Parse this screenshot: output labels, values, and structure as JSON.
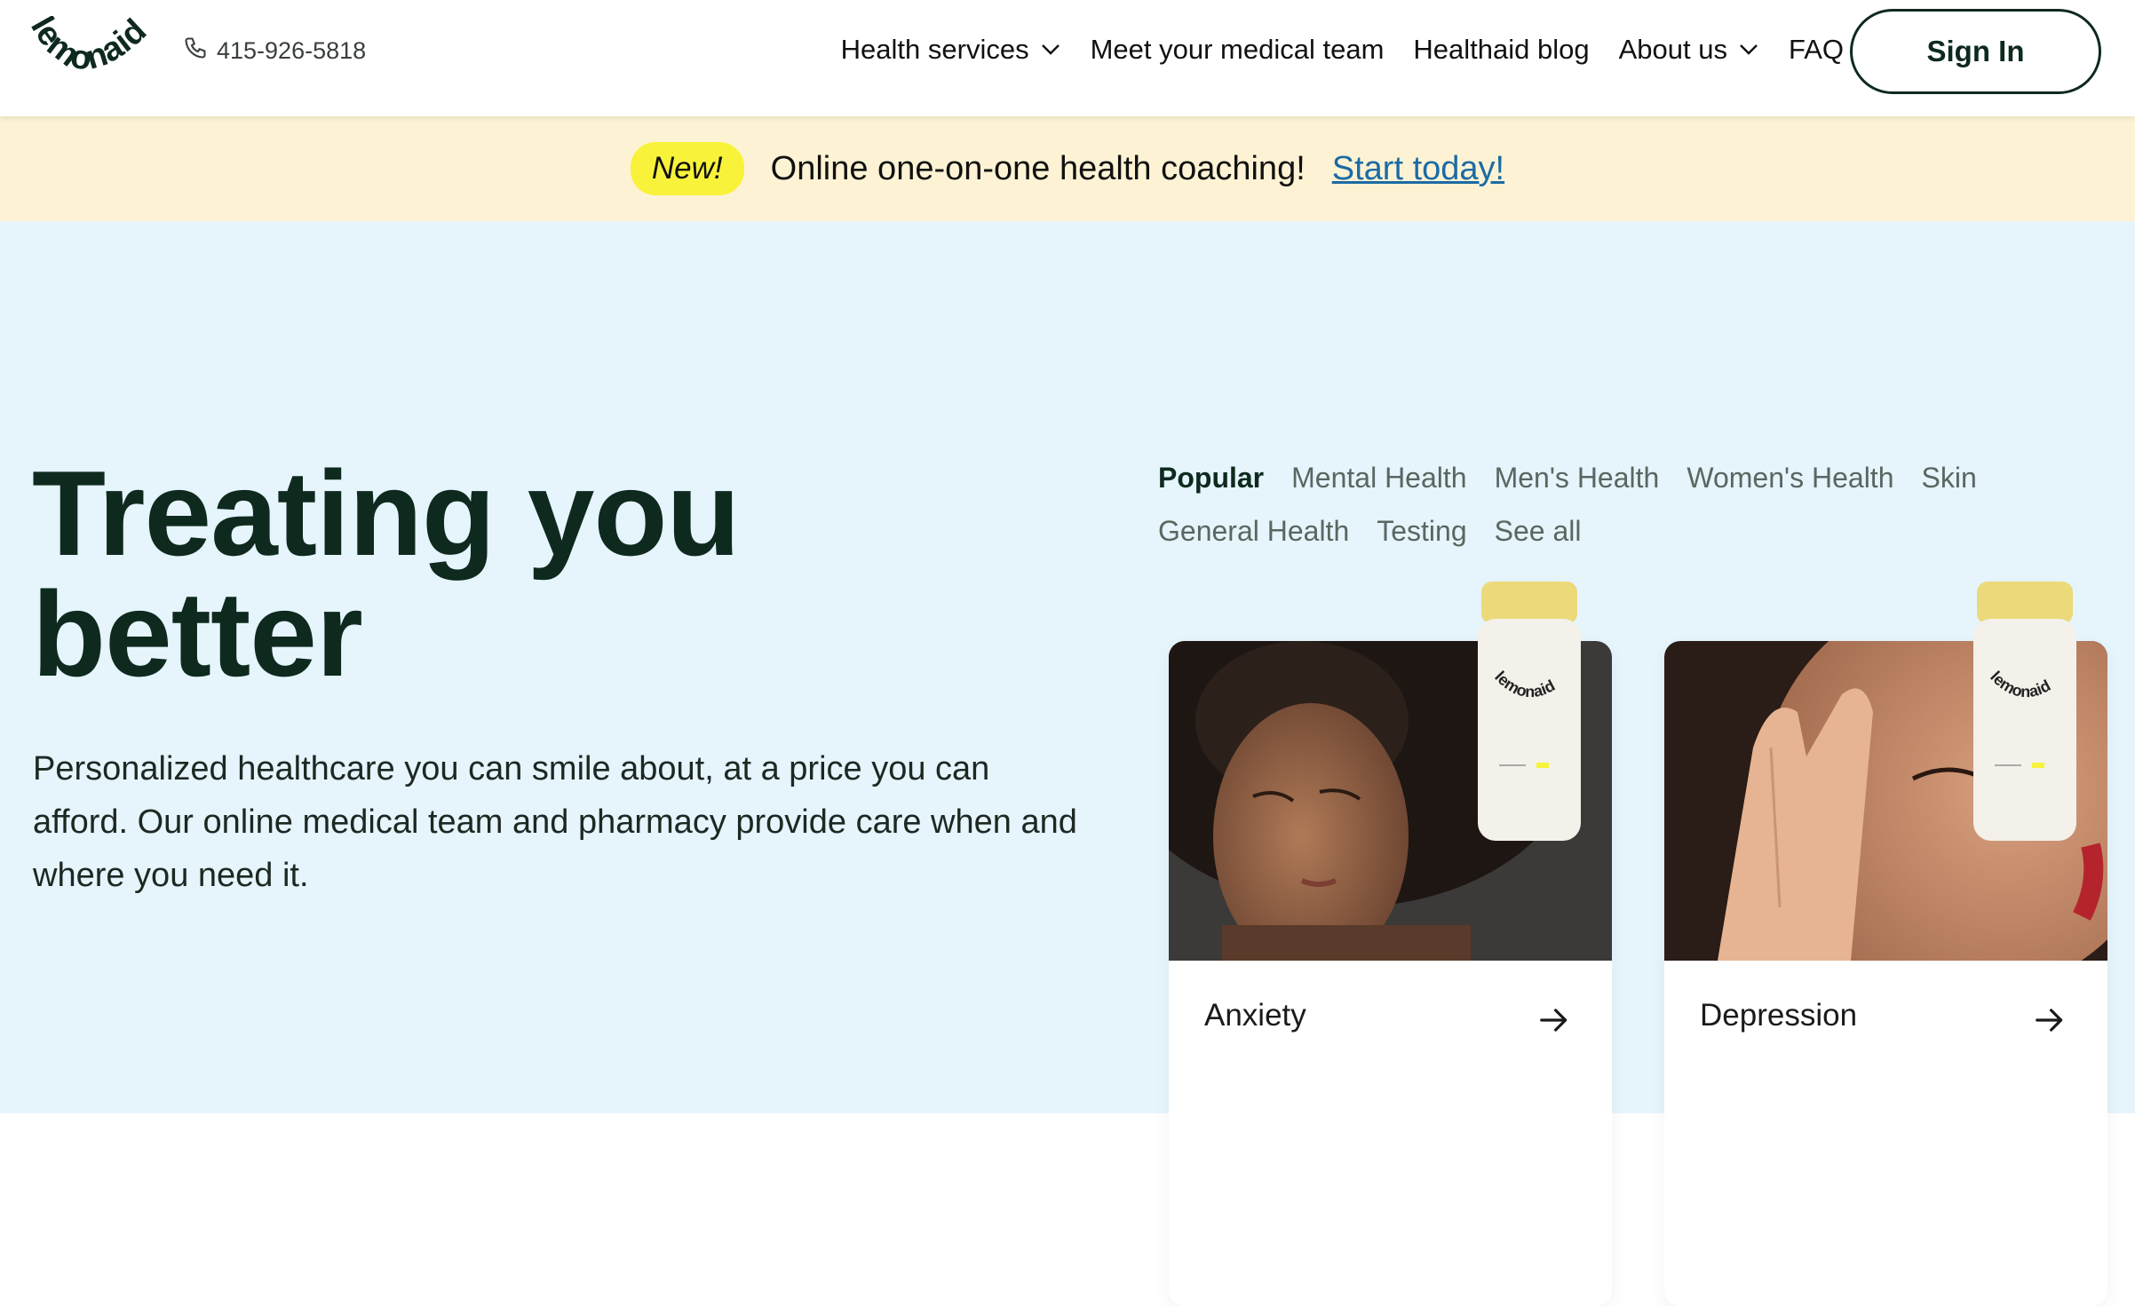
{
  "header": {
    "logo_text": "lemonaid",
    "phone": "415-926-5818",
    "nav": [
      {
        "label": "Health services",
        "has_dropdown": true
      },
      {
        "label": "Meet your medical team",
        "has_dropdown": false
      },
      {
        "label": "Healthaid blog",
        "has_dropdown": false
      },
      {
        "label": "About us",
        "has_dropdown": true
      },
      {
        "label": "FAQ",
        "has_dropdown": false
      }
    ],
    "signin_label": "Sign In"
  },
  "banner": {
    "badge": "New!",
    "text": "Online one-on-one health coaching!",
    "link": "Start today!"
  },
  "hero": {
    "title_line1": "Treating you",
    "title_line2": "better",
    "description": "Personalized healthcare you can smile about, at a price you can afford. Our online medical team and pharmacy provide care when and where you need it."
  },
  "categories": {
    "tabs": [
      "Popular",
      "Mental Health",
      "Men's Health",
      "Women's Health",
      "Skin",
      "General Health",
      "Testing",
      "See all"
    ],
    "active": "Popular"
  },
  "cards": [
    {
      "label": "Anxiety",
      "icon": "arrow-right-icon"
    },
    {
      "label": "Depression",
      "icon": "arrow-right-icon"
    }
  ],
  "colors": {
    "brand_dark": "#0e2a1e",
    "banner_bg": "#fdf3d4",
    "badge_bg": "#f8f33a",
    "hero_bg": "#e6f4fc",
    "link": "#1b6ba4"
  }
}
